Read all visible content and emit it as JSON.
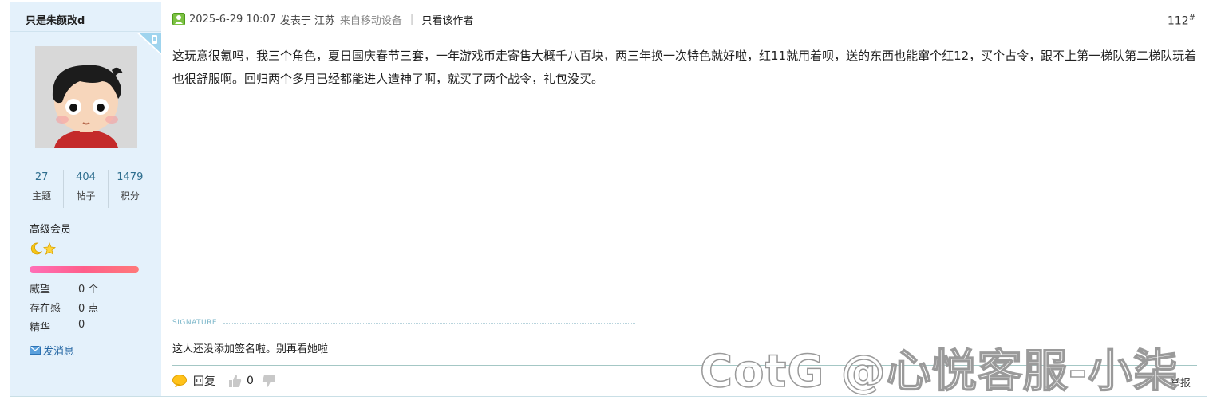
{
  "author": {
    "name": "只是朱颜改d",
    "stats": [
      {
        "value": "27",
        "label": "主题"
      },
      {
        "value": "404",
        "label": "帖子"
      },
      {
        "value": "1479",
        "label": "积分"
      }
    ],
    "rank": "高级会员",
    "level_icons": [
      "moon-icon",
      "star-icon"
    ],
    "progress": 1.0,
    "attributes": [
      {
        "key": "威望",
        "value": "0 个"
      },
      {
        "key": "存在感",
        "value": "0 点"
      },
      {
        "key": "精华",
        "value": "0"
      }
    ],
    "message_label": "发消息"
  },
  "post": {
    "time": "2025-6-29 10:07",
    "posted_in_label": "发表于",
    "region": "江苏",
    "device": "来自移动设备",
    "only_author": "只看该作者",
    "floor": "112",
    "floor_mark": "#",
    "content": "这玩意很氪吗，我三个角色，夏日国庆春节三套，一年游戏币走寄售大概千八百块，两三年换一次特色就好啦，红11就用着呗，送的东西也能窜个红12，买个占令，跟不上第一梯队第二梯队玩着也很舒服啊。回归两个多月已经都能进人造神了啊，就买了两个战令，礼包没买。",
    "signature_label": "SIGNATURE",
    "signature": "这人还没添加签名啦。别再看她啦"
  },
  "actions": {
    "reply_label": "回复",
    "like_count": "0",
    "more_label": "举报"
  },
  "watermark": "CotG @心悦客服-小柒",
  "colors": {
    "sidebar_bg": "#e4f1fb",
    "link": "#2466a3",
    "progress_start": "#ff6fb7",
    "progress_end": "#ff7979"
  }
}
